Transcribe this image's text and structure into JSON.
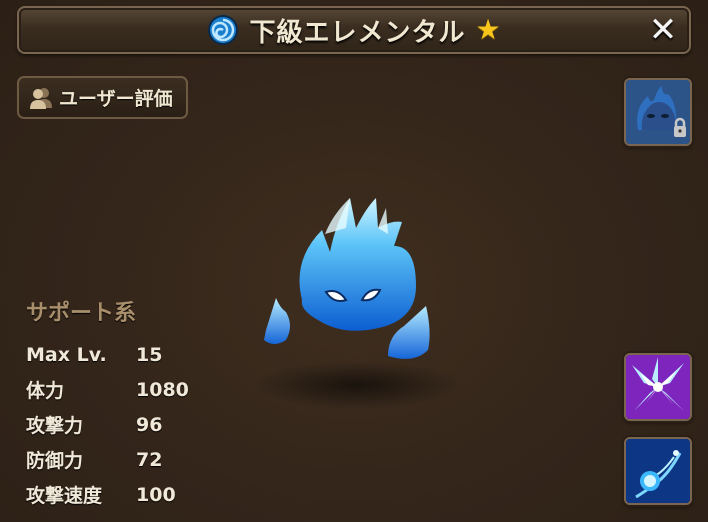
{
  "title": {
    "element_icon": "water-swirl-icon",
    "text": "下級エレメンタル",
    "stars": "★",
    "close_label": "✕"
  },
  "review_button": {
    "icon": "people-icon",
    "label": "ユーザー評価"
  },
  "portrait": {
    "icon": "monster-portrait-locked-icon"
  },
  "skills": [
    {
      "icon": "ice-shards-skill-icon"
    },
    {
      "icon": "water-orb-skill-icon"
    }
  ],
  "stats": {
    "type": "サポート系",
    "rows": [
      {
        "name": "Max Lv.",
        "value": "15"
      },
      {
        "name": "体力",
        "value": "1080"
      },
      {
        "name": "攻撃力",
        "value": "96"
      },
      {
        "name": "防御力",
        "value": "72"
      },
      {
        "name": "攻撃速度",
        "value": "100"
      }
    ]
  },
  "colors": {
    "background": "#35271a",
    "title_text": "#f1e8d2",
    "star": "#f7c51c",
    "type_label": "#a88e6a",
    "monster_blue": "#3aa8f0"
  }
}
